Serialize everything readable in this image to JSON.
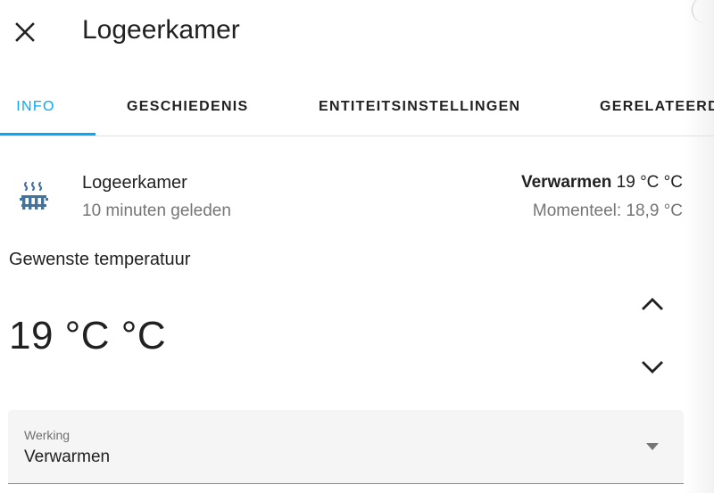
{
  "dialog": {
    "title": "Logeerkamer",
    "close_icon": "close-icon"
  },
  "tabs": [
    {
      "label": "INFO",
      "active": true
    },
    {
      "label": "GESCHIEDENIS",
      "active": false
    },
    {
      "label": "ENTITEITSINSTELLINGEN",
      "active": false
    },
    {
      "label": "GERELATEERD",
      "active": false
    }
  ],
  "entity": {
    "icon": "radiator-icon",
    "name": "Logeerkamer",
    "last_changed": "10 minuten geleden",
    "state_mode": "Verwarmen",
    "state_target": "19 °C °C",
    "current": "Momenteel: 18,9 °C"
  },
  "target": {
    "label": "Gewenste temperatuur",
    "value": "19 °C °C",
    "up_icon": "chevron-up-icon",
    "down_icon": "chevron-down-icon"
  },
  "operation": {
    "label": "Werking",
    "value": "Verwarmen",
    "arrow_icon": "dropdown-arrow-icon"
  },
  "colors": {
    "accent": "#03a9f4",
    "icon": "#44739e",
    "text_primary": "#212121",
    "text_secondary": "#757575",
    "select_bg": "#f5f5f5"
  }
}
